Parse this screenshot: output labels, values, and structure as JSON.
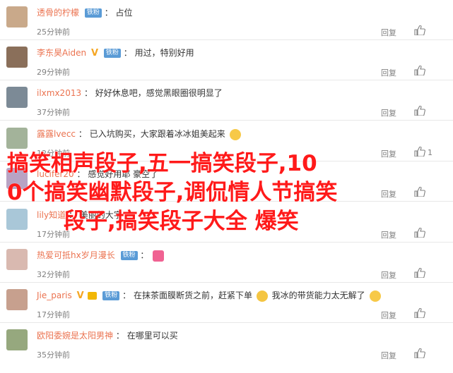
{
  "comments": [
    {
      "user": "透骨的柠檬",
      "badge": "铁粉",
      "text": "占位",
      "time": "25分钟前",
      "reply": "回复",
      "avatar_color": "#c9a98a"
    },
    {
      "user": "李东昊Aiden",
      "badge": "铁粉",
      "vbadge": "V",
      "text": "用过，特别好用",
      "time": "29分钟前",
      "reply": "回复",
      "avatar_color": "#8a6f5a"
    },
    {
      "user": "ilxmx2013",
      "badge": "",
      "text": "好好休息吧，感觉黑眼圈很明显了",
      "time": "37分钟前",
      "reply": "回复",
      "avatar_color": "#7c8a96"
    },
    {
      "user": "露露lvecc",
      "badge": "",
      "text": "已入坑购买，大家跟着冰冰姐美起来",
      "time": "12分钟前",
      "reply": "回复",
      "like_count": "1",
      "avatar_color": "#a3b39a"
    },
    {
      "user": "lucifer20",
      "badge": "",
      "text": "感觉好用耶 豪空了",
      "time": "",
      "reply": "回复",
      "avatar_color": "#b8a3c4"
    },
    {
      "user": "lily知道",
      "badge": "",
      "text": "美丽的大字",
      "time": "17分钟前",
      "reply": "回复",
      "avatar_color": "#a9c7d8"
    },
    {
      "user": "热爱可抵hx岁月漫长",
      "badge": "铁粉",
      "text": "",
      "time": "32分钟前",
      "reply": "回复",
      "avatar_color": "#d9b9b0"
    },
    {
      "user": "Jie_paris",
      "badge": "铁粉",
      "vbadge": "V",
      "text": "在抹茶面膜断货之前，赶紧下单",
      "text2": "我冰的带货能力太无解了",
      "time": "17分钟前",
      "reply": "回复",
      "avatar_color": "#c7a08e"
    },
    {
      "user": "欧阳委婉是太阳男神",
      "badge": "",
      "text": "在哪里可以买",
      "time": "35分钟前",
      "reply": "回复",
      "avatar_color": "#96a87e"
    }
  ],
  "overlay": {
    "line1": "搞笑相声段子,五一搞笑段子,10",
    "line2": "0个搞笑幽默段子,调侃情人节搞笑",
    "line3": "段子,搞笑段子大全 爆笑"
  }
}
